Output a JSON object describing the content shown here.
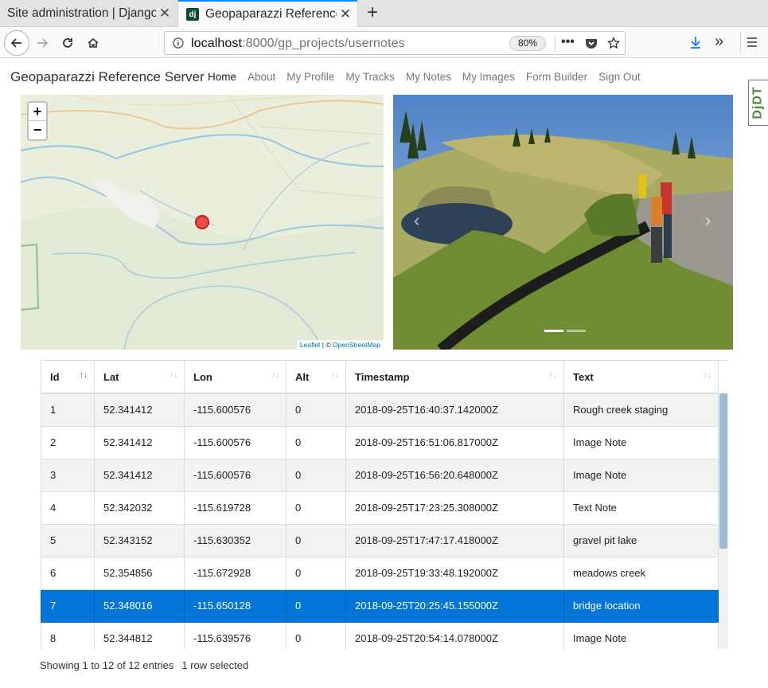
{
  "browser": {
    "tabs": [
      {
        "title": "Site administration | Django",
        "active": false
      },
      {
        "title": "Geopaparazzi Reference Server",
        "active": true,
        "favicon": "dj"
      }
    ],
    "url_prefix": "localhost",
    "url_host_suffix": ":8000/gp_projects/usernotes",
    "zoom": "80%"
  },
  "site": {
    "brand": "Geopaparazzi Reference Server",
    "nav": [
      "Home",
      "About",
      "My Profile",
      "My Tracks",
      "My Notes",
      "My Images",
      "Form Builder",
      "Sign Out"
    ],
    "debug_toolbar_label": "DjDT"
  },
  "map": {
    "zoom_in": "+",
    "zoom_out": "−",
    "attribution_leaflet": "Leaflet",
    "attribution_sep": " | © ",
    "attribution_osm": "OpenStreetMap",
    "colors": {
      "land": "#e6ecd9",
      "river": "#a9cde0",
      "marker": "#e8322f",
      "road": "#f4b86f"
    }
  },
  "carousel": {
    "prev": "‹",
    "next": "›",
    "slides": 2,
    "active_slide": 1
  },
  "table": {
    "columns": [
      "Id",
      "Lat",
      "Lon",
      "Alt",
      "Timestamp",
      "Text"
    ],
    "sort_column": "Id",
    "rows": [
      [
        "1",
        "52.341412",
        "-115.600576",
        "0",
        "2018-09-25T16:40:37.142000Z",
        "Rough creek staging"
      ],
      [
        "2",
        "52.341412",
        "-115.600576",
        "0",
        "2018-09-25T16:51:06.817000Z",
        "Image Note"
      ],
      [
        "3",
        "52.341412",
        "-115.600576",
        "0",
        "2018-09-25T16:56:20.648000Z",
        "Image Note"
      ],
      [
        "4",
        "52.342032",
        "-115.619728",
        "0",
        "2018-09-25T17:23:25.308000Z",
        "Text Note"
      ],
      [
        "5",
        "52.343152",
        "-115.630352",
        "0",
        "2018-09-25T17:47:17.418000Z",
        "gravel pit lake"
      ],
      [
        "6",
        "52.354856",
        "-115.672928",
        "0",
        "2018-09-25T19:33:48.192000Z",
        "meadows creek"
      ],
      [
        "7",
        "52.348016",
        "-115.650128",
        "0",
        "2018-09-25T20:25:45.155000Z",
        "bridge location"
      ],
      [
        "8",
        "52.344812",
        "-115.639576",
        "0",
        "2018-09-25T20:54:14.078000Z",
        "Image Note"
      ]
    ],
    "selected_row": 6,
    "selection_color": "#0275d8",
    "info": "Showing 1 to 12 of 12 entries",
    "selected_info": "1 row selected"
  }
}
